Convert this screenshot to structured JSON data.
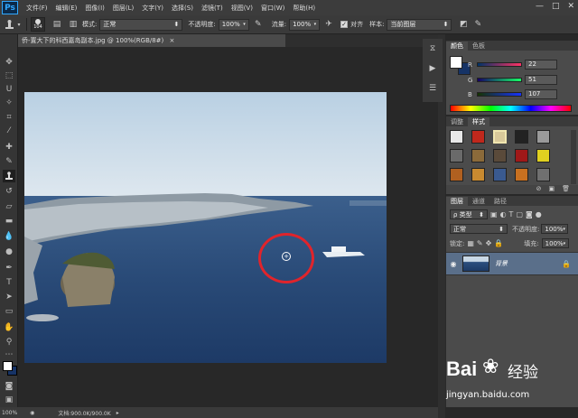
{
  "app": {
    "logo": "Ps"
  },
  "menu": [
    "文件(F)",
    "编辑(E)",
    "图像(I)",
    "图层(L)",
    "文字(Y)",
    "选择(S)",
    "滤镜(T)",
    "视图(V)",
    "窗口(W)",
    "帮助(H)"
  ],
  "window_controls": {
    "minimize": "—",
    "restore": "□",
    "close": "✕"
  },
  "options_bar": {
    "brush_size": "104",
    "mode_label": "模式:",
    "mode_value": "正常",
    "opacity_label": "不透明度:",
    "opacity_value": "100%",
    "flow_label": "流量:",
    "flow_value": "100%",
    "align_label": "对齐",
    "sample_label": "样本:",
    "sample_value": "当前图层"
  },
  "document": {
    "tab_title": "侨-置大下的科西嘉岛副本.jpg @ 100%(RGB/8#)",
    "close": "×"
  },
  "status": {
    "zoom": "100%",
    "doc_info": "文档:900.0K/900.0K"
  },
  "color_panel": {
    "tabs": [
      "颜色",
      "色板"
    ],
    "channels": [
      {
        "label": "R",
        "value": "22",
        "gradient": "linear-gradient(to right,#003366,#ff3366)"
      },
      {
        "label": "G",
        "value": "51",
        "gradient": "linear-gradient(to right,#160066,#16ff66)"
      },
      {
        "label": "B",
        "value": "107",
        "gradient": "linear-gradient(to right,#163300,#1633ff)"
      }
    ],
    "foreground": "#163366",
    "background": "#ffffff"
  },
  "styles_panel": {
    "tabs": [
      "调整",
      "样式"
    ],
    "swatches": [
      "#e8e8e8",
      "#c0281c",
      "#d9c99a",
      "#222222",
      "#9a9a9a",
      "#6a6a6a",
      "#8b6a3a",
      "#5a4a3a",
      "#a01818",
      "#e0d020",
      "#b06020",
      "#c88a30",
      "#3a5a90",
      "#c87020",
      "#707070"
    ]
  },
  "layers_panel": {
    "tabs": [
      "图层",
      "通道",
      "路径"
    ],
    "kind_label": "ρ 类型",
    "blend_mode": "正常",
    "opacity_label": "不透明度:",
    "opacity_value": "100%",
    "lock_label": "锁定:",
    "fill_label": "填充:",
    "fill_value": "100%",
    "layer_name": "背景"
  },
  "watermark": {
    "brand": "Bai",
    "brand2": "经验",
    "url": "jingyan.baidu.com"
  }
}
